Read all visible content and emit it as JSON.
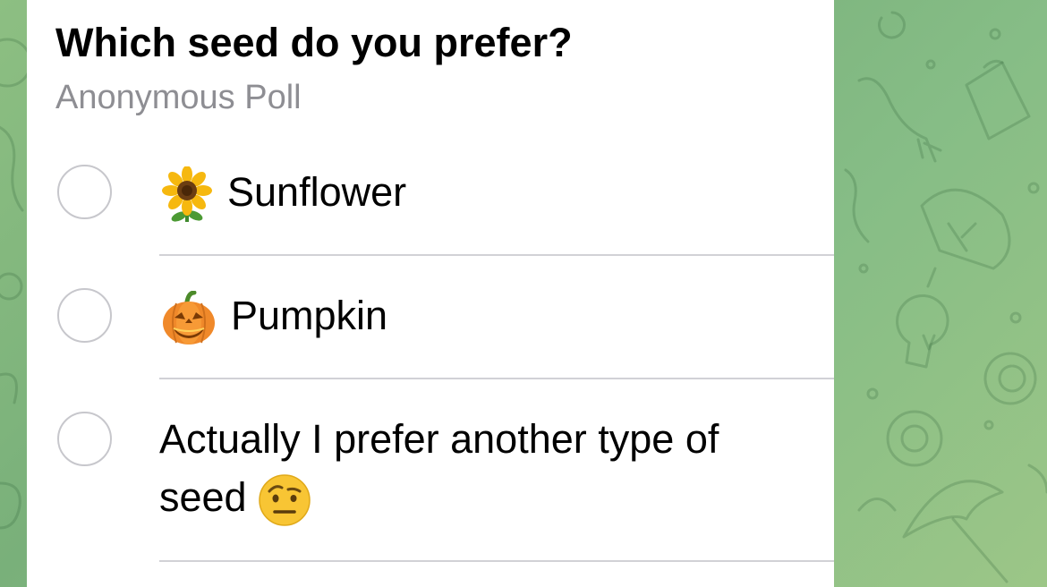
{
  "poll": {
    "question": "Which seed do you prefer?",
    "type_label": "Anonymous Poll",
    "options": [
      {
        "emoji": "sunflower-emoji",
        "label": "Sunflower",
        "selected": false
      },
      {
        "emoji": "jack-o-lantern-emoji",
        "label": "Pumpkin",
        "selected": false
      },
      {
        "line1": "Actually I prefer another type of",
        "line2": "seed",
        "emoji": "face-with-raised-eyebrow-emoji",
        "selected": false
      }
    ]
  },
  "colors": {
    "wallpaper": "#86bb84",
    "card": "#ffffff",
    "radio_border": "#c7c7cc",
    "subtitle": "#8e8e93",
    "divider": "#d1d1d6"
  }
}
